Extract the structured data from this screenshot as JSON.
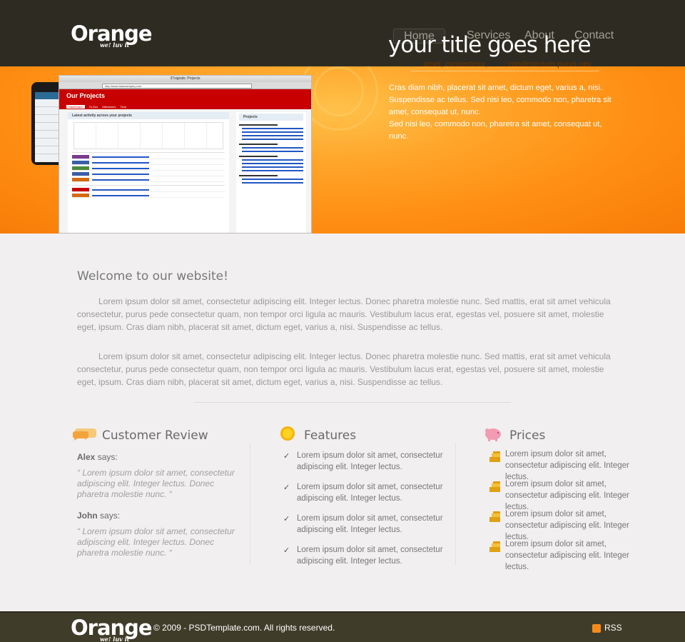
{
  "brand": {
    "name": "Orange",
    "tagline": "we! luv it"
  },
  "nav": {
    "items": [
      "Home",
      "Services",
      "About",
      "Contact"
    ],
    "active": "Home"
  },
  "banner": {
    "title": "your title goes here",
    "subtitle_1": "amet, consectetur,",
    "subtitle_2": "condimentum purus nec",
    "text_1": "Cras diam nibh, placerat sit amet, dictum eget, varius a, nisi. Suspendisse ac tellus. Sed nisi leo, commodo non, pharetra sit amet, consequat ut, nunc.",
    "text_2": "Sed nisi leo, commodo non, pharetra sit amet, consequat ut, nunc.",
    "screenshot": {
      "window_title": "37signals: Projects",
      "url": "http://www.basecamphq.com",
      "heading": "Our Projects",
      "tabs": [
        "Dashboard",
        "To-Dos",
        "Milestones",
        "Time"
      ],
      "section": "Latest activity across your projects",
      "sidebar_title": "Projects"
    }
  },
  "welcome": {
    "title": "Welcome to our website!",
    "paragraph_1": "Lorem ipsum dolor sit amet, consectetur adipiscing elit. Integer lectus. Donec pharetra molestie nunc. Sed mattis, erat sit amet vehicula consectetur, purus pede consectetur quam, non tempor orci ligula ac mauris. Vestibulum lacus erat, egestas vel, posuere sit amet, molestie eget, ipsum. Cras diam nibh, placerat sit amet, dictum eget, varius a, nisi. Suspendisse ac tellus.",
    "paragraph_2": "Lorem ipsum dolor sit amet, consectetur adipiscing elit. Integer lectus. Donec pharetra molestie nunc. Sed mattis, erat sit amet vehicula consectetur, purus pede consectetur quam, non tempor orci ligula ac mauris. Vestibulum lacus erat, egestas vel, posuere sit amet, molestie eget, ipsum. Cras diam nibh, placerat sit amet, dictum eget, varius a, nisi. Suspendisse ac tellus."
  },
  "review": {
    "title": "Customer Review",
    "icon": "speech-bubbles-icon",
    "says": "says:",
    "items": [
      {
        "name": "Alex",
        "quote": "“ Lorem ipsum dolor sit amet, consectetur adipiscing elit. Integer lectus. Donec pharetra molestie nunc. “"
      },
      {
        "name": "John",
        "quote": "“ Lorem ipsum dolor sit amet, consectetur adipiscing elit. Integer lectus. Donec pharetra molestie nunc. “"
      }
    ]
  },
  "features": {
    "title": "Features",
    "icon": "sun-icon",
    "items": [
      "Lorem ipsum dolor sit amet, consectetur adipiscing elit. Integer lectus.",
      "Lorem ipsum dolor sit amet, consectetur adipiscing elit. Integer lectus.",
      "Lorem ipsum dolor sit amet, consectetur adipiscing elit. Integer lectus.",
      "Lorem ipsum dolor sit amet, consectetur adipiscing elit. Integer lectus."
    ]
  },
  "prices": {
    "title": "Prices",
    "icon": "piggy-bank-icon",
    "items": [
      "Lorem ipsum dolor sit amet, consectetur adipiscing elit. Integer lectus.",
      "Lorem ipsum dolor sit amet, consectetur adipiscing elit. Integer lectus.",
      "Lorem ipsum dolor sit amet, consectetur adipiscing elit. Integer lectus.",
      "Lorem ipsum dolor sit amet, consectetur adipiscing elit. Integer lectus."
    ]
  },
  "footer": {
    "copyright": "© 2009 - PSDTemplate.com. All rights reserved.",
    "rss": "RSS"
  },
  "colors": {
    "header": "#2e2c22",
    "banner": "#ff8d12",
    "footer": "#403c2a",
    "background": "#f1eff0"
  }
}
